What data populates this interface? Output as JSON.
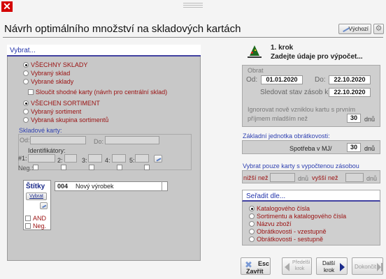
{
  "window": {
    "close_glyph": "✕",
    "title": "Návrh optimálního množství na skladových kartách"
  },
  "header": {
    "default_button": "Výchozí"
  },
  "select_panel": {
    "heading": "Vybrat...",
    "warehouse_options": [
      "VŠECHNY SKLADY",
      "Vybraný sklad",
      "Vybrané sklady"
    ],
    "merge_cards": "Sloučit shodné karty (návrh pro centrální sklad)",
    "assortment_options": [
      "VŠECHEN SORTIMENT",
      "Vybraný sortiment",
      "Vybraná skupina sortimentů"
    ],
    "cards_group": "Skladové karty:",
    "from_label": "Od:",
    "to_label": "Do:",
    "identifiers_label": "Identifikátory:",
    "id_labels": [
      "#1:",
      "2:",
      "3:",
      "4:",
      "5:"
    ],
    "neg_label": "Neg.:"
  },
  "tags": {
    "label": "Štítky",
    "select_button": "Vybrat",
    "code": "004",
    "name": "Nový výrobek",
    "and_label": "AND",
    "neg_label": "Neg."
  },
  "step": {
    "title": "1. krok",
    "subtitle": "Zadejte údaje pro výpočet..."
  },
  "period": {
    "label": "Obrat",
    "from_label": "Od:",
    "from": "01.01.2020",
    "to_label": "Do:",
    "to": "22.10.2020",
    "track_label": "Sledovat stav zásob k:",
    "track": "22.10.2020",
    "ignore_line1": "Ignorovat nově vzniklou kartu s prvním",
    "ignore_line2": "příjmem mladším než",
    "ignore_value": "30",
    "ignore_unit": "dnů"
  },
  "turnover": {
    "label": "Základní jednotka obrátkovosti:",
    "text": "Spotřeba v MJ/",
    "value": "30",
    "unit": "dnů"
  },
  "filter": {
    "label": "Vybrat pouze karty s vypočtenou zásobou",
    "lower_label": "nižší než",
    "lower_unit": "dnů",
    "higher_label": "vyšší než",
    "higher_unit": "dnů"
  },
  "sort": {
    "heading": "Seřadit dle...",
    "options": [
      "Katalogového čísla",
      "Sortimentu a katalogového čísla",
      "Názvu zboží",
      "Obrátkovosti - vzestupně",
      "Obrátkovosti - sestupně"
    ]
  },
  "footer": {
    "esc_label": "Esc",
    "close_label": "Zavřít",
    "prev_line1": "Předelší",
    "prev_line2": "krok",
    "next_line1": "Další",
    "next_line2": "krok",
    "finish_label": "Dokončit"
  },
  "icons": [
    "close-icon",
    "pen-icon",
    "gear-icon",
    "wizard-icon",
    "pick-icon",
    "arrow-left-icon",
    "arrow-right-icon"
  ]
}
